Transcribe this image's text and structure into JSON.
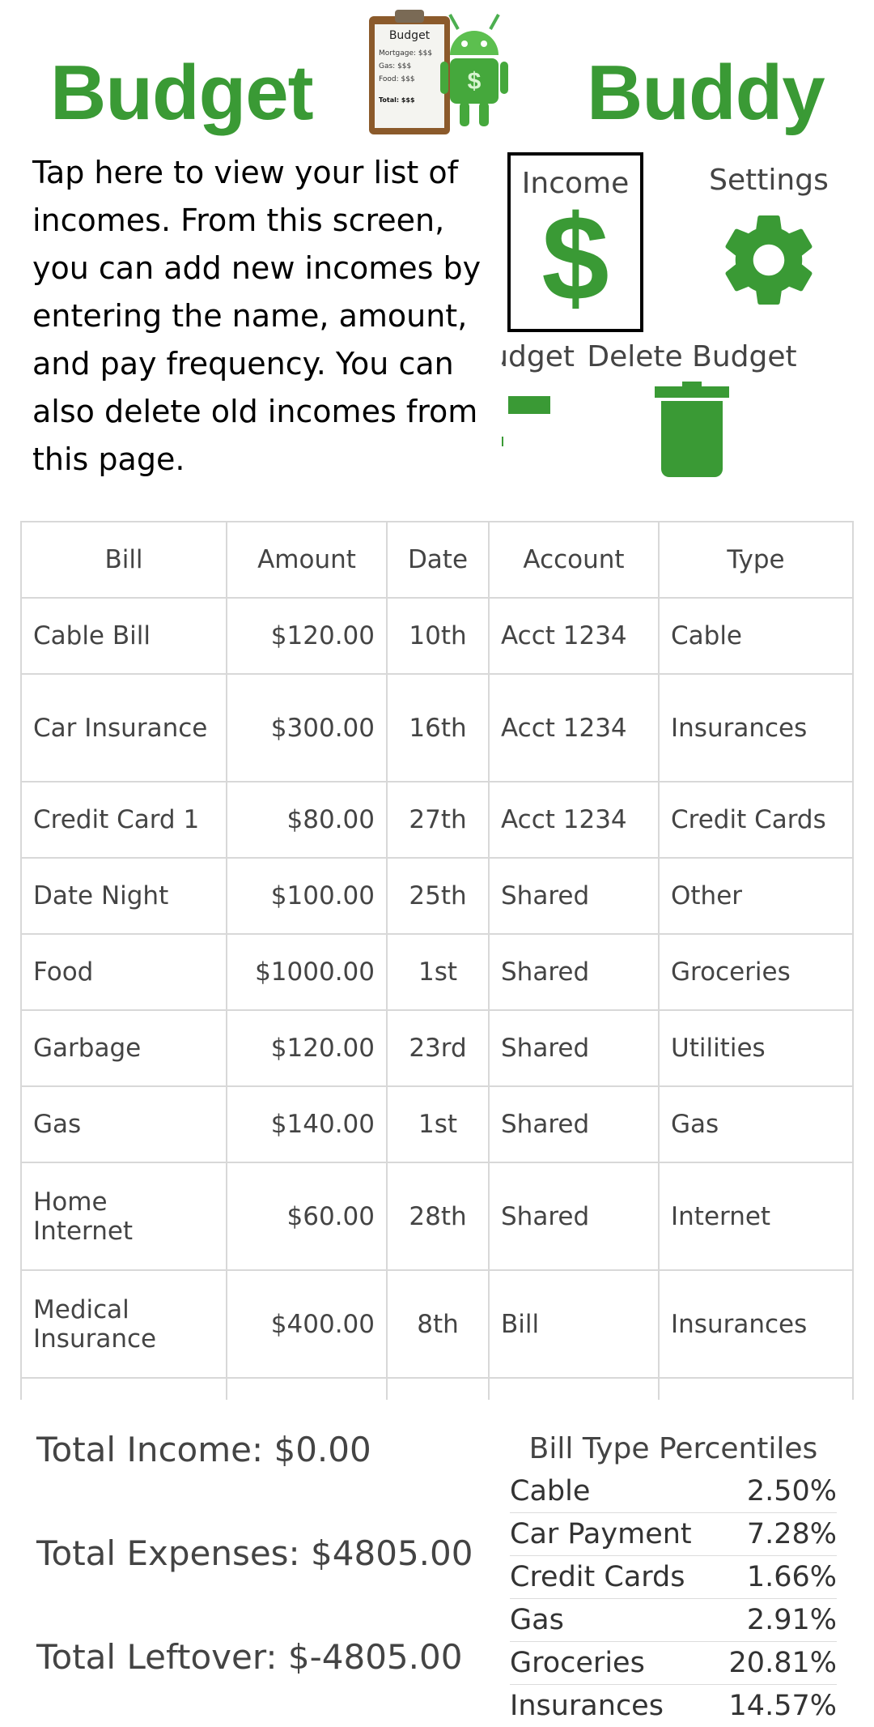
{
  "header": {
    "title_left": "Budget",
    "title_right": "Buddy",
    "logo": {
      "clipboard_title": "Budget",
      "lines": [
        "Mortgage: $$$",
        "Gas:   $$$",
        "Food:  $$$"
      ],
      "total": "Total: $$$"
    }
  },
  "nav": {
    "income_label": "Income",
    "income_symbol": "$",
    "settings_label": "Settings",
    "budget_label": "udget",
    "delete_label": "Delete Budget"
  },
  "tooltip": {
    "text": "Tap here to view your list of incomes. From this screen, you can add new incomes by entering the name, amount, and pay frequency. You can also delete old incomes from this page."
  },
  "table": {
    "headers": [
      "Bill",
      "Amount",
      "Date",
      "Account",
      "Type"
    ],
    "rows": [
      {
        "bill": "Cable Bill",
        "amount": "$120.00",
        "date": "10th",
        "account": "Acct 1234",
        "type": "Cable"
      },
      {
        "bill": "Car Insurance",
        "amount": "$300.00",
        "date": "16th",
        "account": "Acct 1234",
        "type": "Insurances"
      },
      {
        "bill": "Credit Card 1",
        "amount": "$80.00",
        "date": "27th",
        "account": "Acct 1234",
        "type": "Credit Cards"
      },
      {
        "bill": "Date Night",
        "amount": "$100.00",
        "date": "25th",
        "account": "Shared",
        "type": "Other"
      },
      {
        "bill": "Food",
        "amount": "$1000.00",
        "date": "1st",
        "account": "Shared",
        "type": "Groceries"
      },
      {
        "bill": "Garbage",
        "amount": "$120.00",
        "date": "23rd",
        "account": "Shared",
        "type": "Utilities"
      },
      {
        "bill": "Gas",
        "amount": "$140.00",
        "date": "1st",
        "account": "Shared",
        "type": "Gas"
      },
      {
        "bill": "Home Internet",
        "amount": "$60.00",
        "date": "28th",
        "account": "Shared",
        "type": "Internet"
      },
      {
        "bill": "Medical Insurance",
        "amount": "$400.00",
        "date": "8th",
        "account": "Bill",
        "type": "Insurances"
      }
    ]
  },
  "totals": {
    "income": "Total Income: $0.00",
    "expenses": "Total Expenses: $4805.00",
    "leftover": "Total Leftover: $-4805.00"
  },
  "percentiles": {
    "title": "Bill Type Percentiles",
    "items": [
      {
        "label": "Cable",
        "value": "2.50%"
      },
      {
        "label": "Car Payment",
        "value": "7.28%"
      },
      {
        "label": "Credit Cards",
        "value": "1.66%"
      },
      {
        "label": "Gas",
        "value": "2.91%"
      },
      {
        "label": "Groceries",
        "value": "20.81%"
      },
      {
        "label": "Insurances",
        "value": "14.57%"
      }
    ]
  },
  "colors": {
    "brand_green": "#3a9a35",
    "text": "#444444",
    "table_border": "#d8d8d8"
  }
}
